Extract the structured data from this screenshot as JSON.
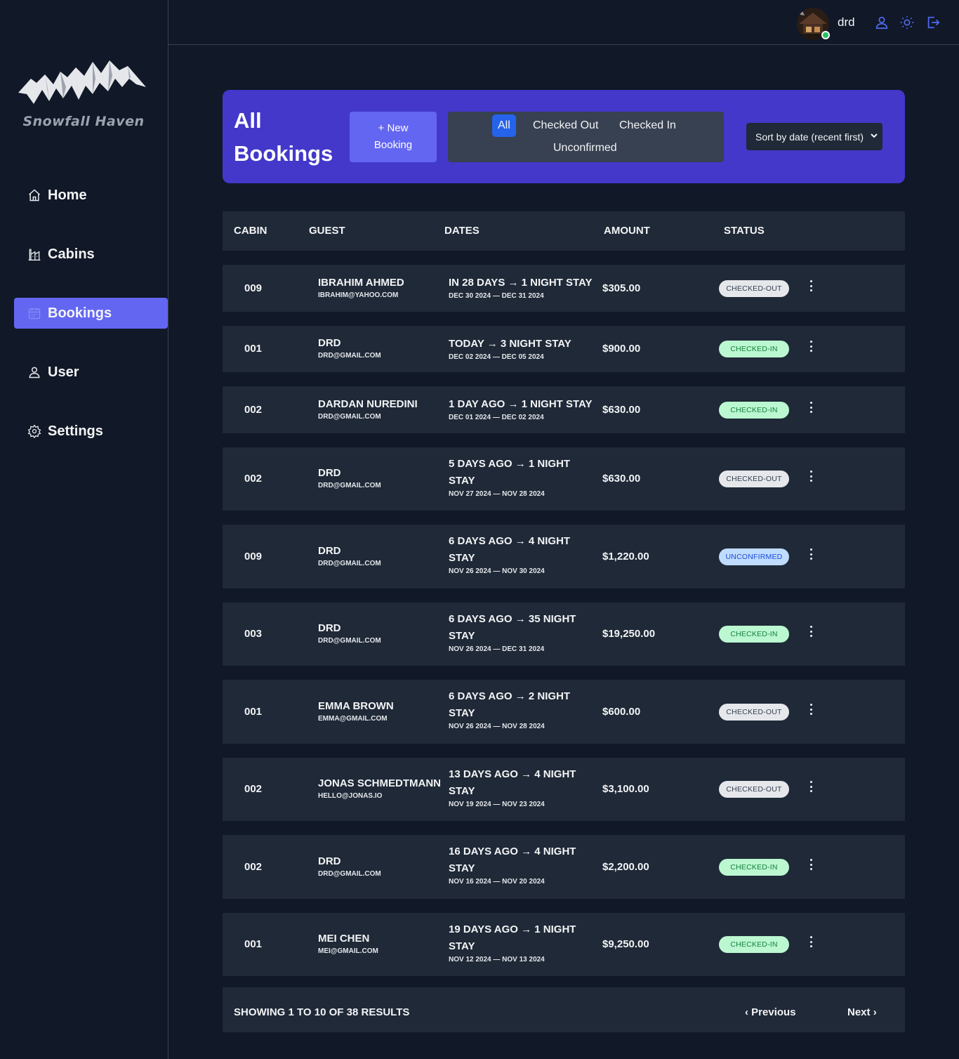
{
  "app": {
    "brand": "Snowfall Haven"
  },
  "sidebar": {
    "items": [
      {
        "label": "Home",
        "icon": "home-icon"
      },
      {
        "label": "Cabins",
        "icon": "cabin-icon"
      },
      {
        "label": "Bookings",
        "icon": "calendar-icon",
        "active": true
      },
      {
        "label": "User",
        "icon": "user-icon"
      },
      {
        "label": "Settings",
        "icon": "gear-icon"
      }
    ]
  },
  "header": {
    "username": "drd",
    "icons": [
      "user-icon",
      "sun-icon",
      "logout-icon"
    ]
  },
  "page": {
    "title_line1": "All",
    "title_line2": "Bookings",
    "new_booking_line1": "+ New",
    "new_booking_line2": "Booking",
    "filters": [
      "All",
      "Checked Out",
      "Checked In",
      "Unconfirmed"
    ],
    "active_filter": "All",
    "sort_label": "Sort by date (recent first)"
  },
  "table": {
    "headers": [
      "CABIN",
      "GUEST",
      "DATES",
      "AMOUNT",
      "STATUS"
    ],
    "rows": [
      {
        "cabin": "009",
        "guest": "IBRAHIM AHMED",
        "email": "IBRAHIM@YAHOO.COM",
        "dates_line1": "IN 28 DAYS → 1 NIGHT STAY",
        "dates_line2": "",
        "range": "DEC 30 2024 — DEC 31 2024",
        "amount": "$305.00",
        "status": "CHECKED-OUT"
      },
      {
        "cabin": "001",
        "guest": "DRD",
        "email": "DRD@GMAIL.COM",
        "dates_line1": "TODAY → 3 NIGHT STAY",
        "dates_line2": "",
        "range": "DEC 02 2024 — DEC 05 2024",
        "amount": "$900.00",
        "status": "CHECKED-IN"
      },
      {
        "cabin": "002",
        "guest": "DARDAN NUREDINI",
        "email": "DRD@GMAIL.COM",
        "dates_line1": "1 DAY AGO → 1 NIGHT STAY",
        "dates_line2": "",
        "range": "DEC 01 2024 — DEC 02 2024",
        "amount": "$630.00",
        "status": "CHECKED-IN"
      },
      {
        "cabin": "002",
        "guest": "DRD",
        "email": "DRD@GMAIL.COM",
        "dates_line1": "5 DAYS AGO → 1 NIGHT",
        "dates_line2": "STAY",
        "range": "NOV 27 2024 — NOV 28 2024",
        "amount": "$630.00",
        "status": "CHECKED-OUT"
      },
      {
        "cabin": "009",
        "guest": "DRD",
        "email": "DRD@GMAIL.COM",
        "dates_line1": "6 DAYS AGO → 4 NIGHT",
        "dates_line2": "STAY",
        "range": "NOV 26 2024 — NOV 30 2024",
        "amount": "$1,220.00",
        "status": "UNCONFIRMED"
      },
      {
        "cabin": "003",
        "guest": "DRD",
        "email": "DRD@GMAIL.COM",
        "dates_line1": "6 DAYS AGO → 35 NIGHT",
        "dates_line2": "STAY",
        "range": "NOV 26 2024 — DEC 31 2024",
        "amount": "$19,250.00",
        "status": "CHECKED-IN"
      },
      {
        "cabin": "001",
        "guest": "EMMA BROWN",
        "email": "EMMA@GMAIL.COM",
        "dates_line1": "6 DAYS AGO → 2 NIGHT",
        "dates_line2": "STAY",
        "range": "NOV 26 2024 — NOV 28 2024",
        "amount": "$600.00",
        "status": "CHECKED-OUT"
      },
      {
        "cabin": "002",
        "guest": "JONAS SCHMEDTMANN",
        "email": "HELLO@JONAS.IO",
        "dates_line1": "13 DAYS AGO → 4 NIGHT",
        "dates_line2": "STAY",
        "range": "NOV 19 2024 — NOV 23 2024",
        "amount": "$3,100.00",
        "status": "CHECKED-OUT"
      },
      {
        "cabin": "002",
        "guest": "DRD",
        "email": "DRD@GMAIL.COM",
        "dates_line1": "16 DAYS AGO → 4 NIGHT",
        "dates_line2": "STAY",
        "range": "NOV 16 2024 — NOV 20 2024",
        "amount": "$2,200.00",
        "status": "CHECKED-IN"
      },
      {
        "cabin": "001",
        "guest": "MEI CHEN",
        "email": "MEI@GMAIL.COM",
        "dates_line1": "19 DAYS AGO → 1 NIGHT",
        "dates_line2": "STAY",
        "range": "NOV 12 2024 — NOV 13 2024",
        "amount": "$9,250.00",
        "status": "CHECKED-IN"
      }
    ]
  },
  "pagination": {
    "showing_prefix": "SHOWING",
    "from": "1",
    "to_word": "TO",
    "to": "10",
    "of_word": "OF",
    "total": "38",
    "results_word": "RESULTS",
    "previous": "Previous",
    "next": "Next"
  }
}
